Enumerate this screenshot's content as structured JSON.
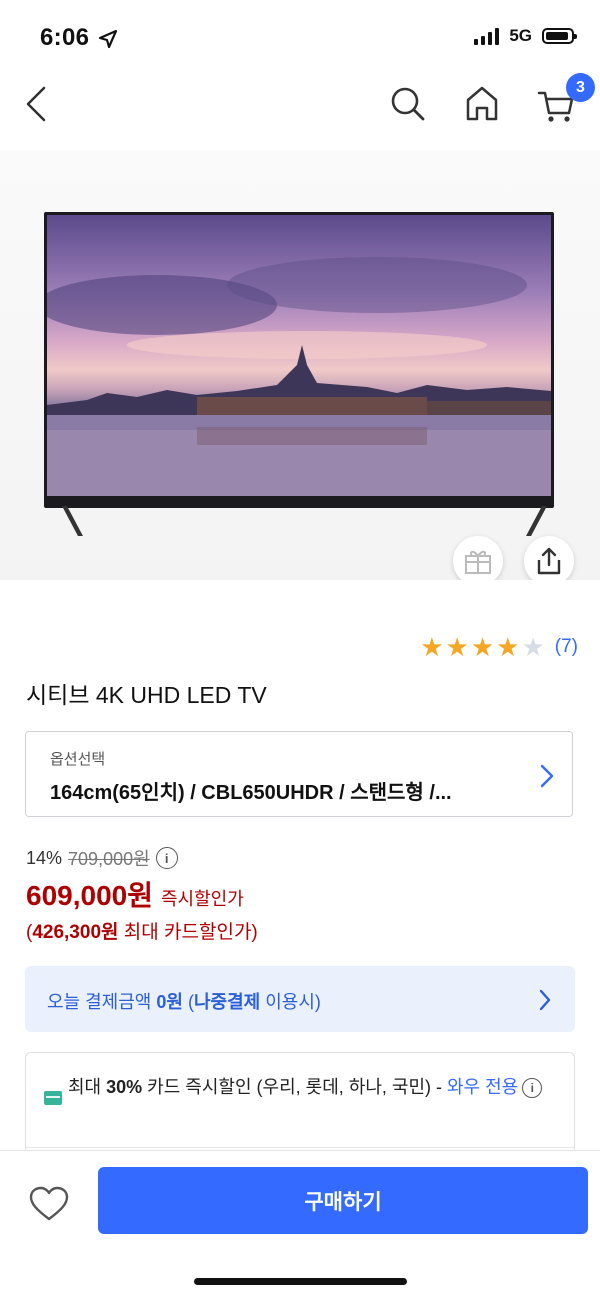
{
  "status": {
    "time": "6:06",
    "network": "5G"
  },
  "nav": {
    "cart_count": "3"
  },
  "rating": {
    "stars": 4,
    "max_stars": 5,
    "count": "(7)"
  },
  "product": {
    "title": "시티브 4K UHD LED TV"
  },
  "option": {
    "label": "옵션선택",
    "value": "164cm(65인치) / CBL650UHDR / 스탠드형 /..."
  },
  "price": {
    "discount": "14%",
    "original": "709,000원",
    "sale": "609,000원",
    "sale_label": "즉시할인가",
    "card_open": "(",
    "card_price": "426,300원",
    "card_label": " 최대 카드할인가)"
  },
  "pay_later": {
    "prefix": "오늘 결제금액 ",
    "amount": "0원",
    "paren_open": " (",
    "method": "나중결제",
    "suffix": " 이용시)"
  },
  "card_benefit": {
    "prefix": "최대 ",
    "percent": "30%",
    "middle": " 카드 즉시할인 (우리, 롯데, 하나, 국민) - ",
    "wow": "와우 전용"
  },
  "bottom": {
    "buy_label": "구매하기"
  },
  "colors": {
    "accent": "#346aff",
    "price": "#ae0000",
    "star": "#f5a623"
  }
}
